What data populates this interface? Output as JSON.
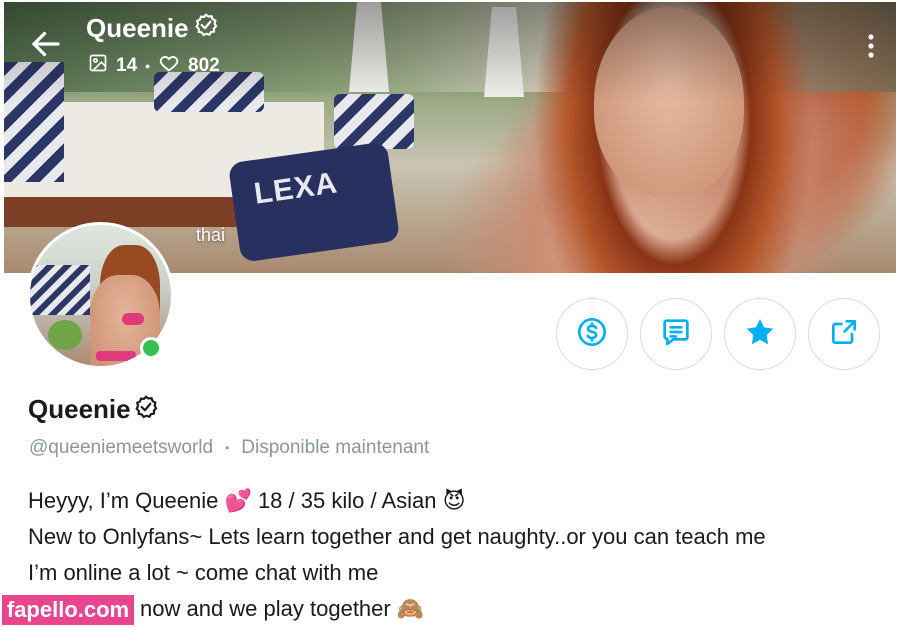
{
  "header": {
    "name": "Queenie",
    "media_count": "14",
    "likes_count": "802",
    "separator": "•",
    "cover_tag": "thai"
  },
  "profile": {
    "display_name": "Queenie",
    "handle": "@queeniemeetsworld",
    "handle_separator": "•",
    "status": "Disponible maintenant",
    "online": true
  },
  "actions": {
    "tip_icon": "dollar-circle-icon",
    "message_icon": "message-icon",
    "favorite_icon": "star-icon",
    "share_icon": "share-icon"
  },
  "bio": {
    "line1": "Heyyy, I’m Queenie 💕  18 / 35 kilo / Asian 😈",
    "line2": "New to Onlyfans~ Lets learn together and get naughty..or you can teach me",
    "line3": "I’m online a lot ~ come chat with me",
    "line4": "now and we play together 🙈"
  },
  "watermark": "fapello.com",
  "colors": {
    "accent": "#00aff0",
    "online": "#33c24d",
    "muted_text": "#8a96a3",
    "watermark_bg": "#e8458f"
  }
}
